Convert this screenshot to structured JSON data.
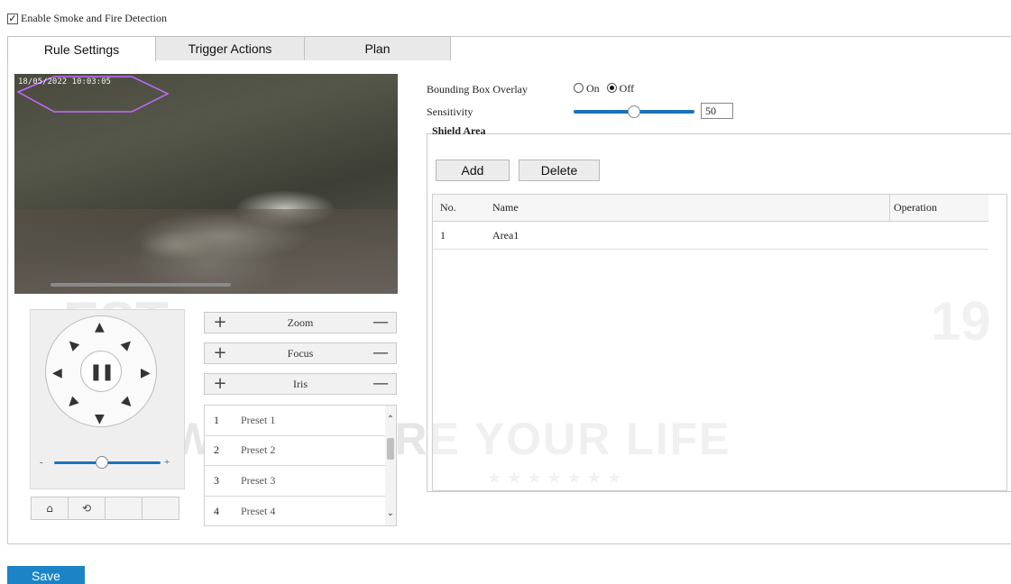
{
  "enable": {
    "label": "Enable Smoke and Fire Detection",
    "checked": true
  },
  "tabs": [
    {
      "label": "Rule Settings",
      "active": true
    },
    {
      "label": "Trigger Actions",
      "active": false
    },
    {
      "label": "Plan",
      "active": false
    }
  ],
  "video": {
    "timestamp": "18/05/2022 10:03:05"
  },
  "ptz": {
    "speed_min": "-",
    "speed_max": "+",
    "speed_level": 0.45
  },
  "lens": [
    {
      "label": "Zoom",
      "plus": "+",
      "minus": "—"
    },
    {
      "label": "Focus",
      "plus": "+",
      "minus": "—"
    },
    {
      "label": "Iris",
      "plus": "+",
      "minus": "—"
    }
  ],
  "presets": [
    {
      "num": "1",
      "name": "Preset 1"
    },
    {
      "num": "2",
      "name": "Preset 2"
    },
    {
      "num": "3",
      "name": "Preset 3"
    },
    {
      "num": "4",
      "name": "Preset 4"
    }
  ],
  "settings": {
    "overlay_label": "Bounding Box Overlay",
    "on_label": "On",
    "off_label": "Off",
    "overlay_value": "Off",
    "sensitivity_label": "Sensitivity",
    "sensitivity_value": "50"
  },
  "shield": {
    "title": "Shield Area",
    "add_label": "Add",
    "delete_label": "Delete",
    "columns": [
      "No.",
      "Name",
      "Operation"
    ],
    "rows": [
      {
        "no": "1",
        "name": "Area1"
      }
    ]
  },
  "save_label": "Save",
  "watermark": {
    "text": "WE SECURE YOUR LIFE",
    "est": "EST.",
    "year": "19"
  },
  "colors": {
    "accent": "#1a84c7",
    "slider": "#1a73b8",
    "roi": "#c56bff"
  }
}
